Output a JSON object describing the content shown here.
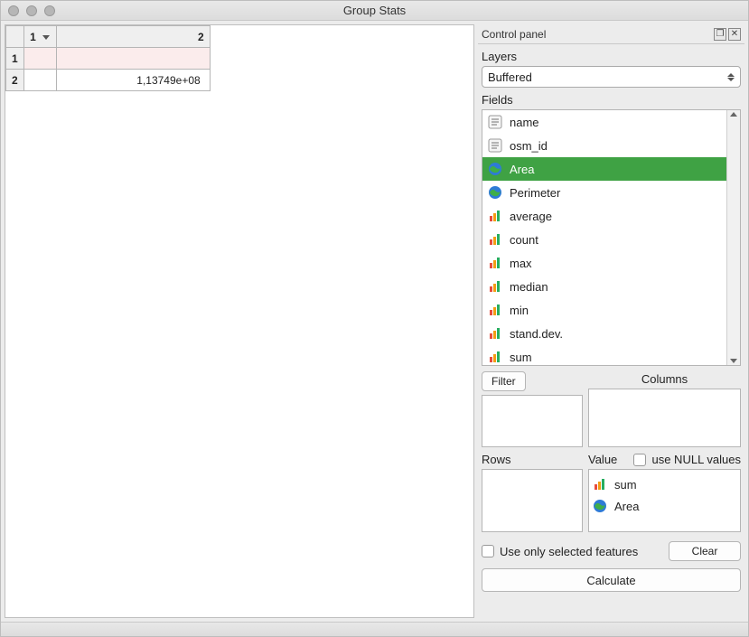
{
  "window": {
    "title": "Group Stats"
  },
  "results": {
    "colHeaders": [
      "1",
      "2"
    ],
    "rows": [
      {
        "head": "1",
        "c1": "",
        "c2": ""
      },
      {
        "head": "2",
        "c1": "",
        "c2": "1,13749e+08"
      }
    ]
  },
  "panel": {
    "title": "Control panel",
    "layersLabel": "Layers",
    "layerSelected": "Buffered",
    "fieldsLabel": "Fields",
    "fields": [
      {
        "label": "name",
        "icon": "text",
        "selected": false
      },
      {
        "label": "osm_id",
        "icon": "text",
        "selected": false
      },
      {
        "label": "Area",
        "icon": "globe",
        "selected": true
      },
      {
        "label": "Perimeter",
        "icon": "globe",
        "selected": false
      },
      {
        "label": "average",
        "icon": "bars",
        "selected": false
      },
      {
        "label": "count",
        "icon": "bars",
        "selected": false
      },
      {
        "label": "max",
        "icon": "bars",
        "selected": false
      },
      {
        "label": "median",
        "icon": "bars",
        "selected": false
      },
      {
        "label": "min",
        "icon": "bars",
        "selected": false
      },
      {
        "label": "stand.dev.",
        "icon": "bars",
        "selected": false
      },
      {
        "label": "sum",
        "icon": "bars",
        "selected": false
      }
    ],
    "filterLabel": "Filter",
    "columnsLabel": "Columns",
    "rowsLabel": "Rows",
    "valueLabel": "Value",
    "nullLabel": "use NULL values",
    "valueItems": [
      {
        "label": "sum",
        "icon": "bars"
      },
      {
        "label": "Area",
        "icon": "globe"
      }
    ],
    "onlySelectedLabel": "Use only selected features",
    "clearLabel": "Clear",
    "calculateLabel": "Calculate"
  }
}
